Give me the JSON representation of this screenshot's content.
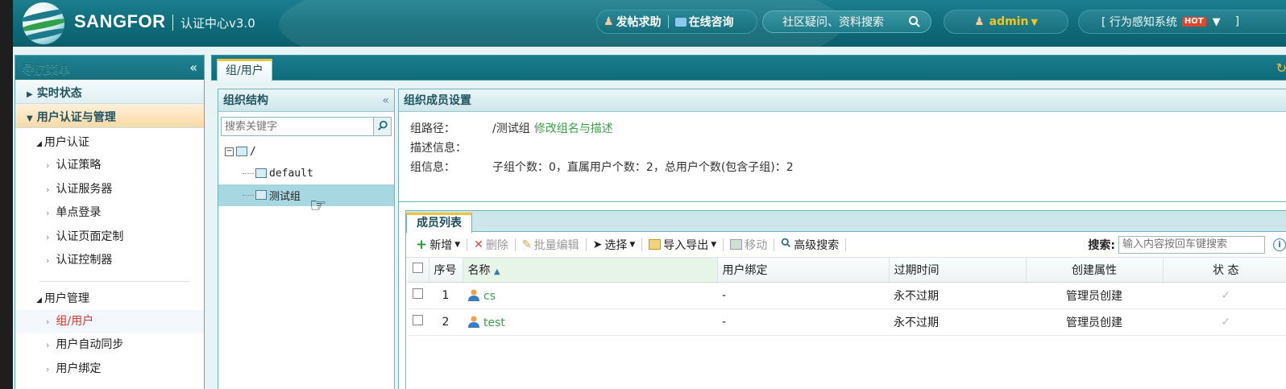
{
  "header": {
    "brand": "SANGFOR",
    "subtitle": "认证中心v3.0",
    "help_label": "发帖求助",
    "consult_label": "在线咨询",
    "search_placeholder": "社区疑问、资料搜索",
    "user": "admin",
    "behavior_label": "[ 行为感知系统",
    "hot_badge": "HOT",
    "close_bracket": "]"
  },
  "nav": {
    "title": "导航菜单",
    "sections": [
      {
        "label": "实时状态"
      },
      {
        "label": "用户认证与管理"
      }
    ],
    "groups": [
      {
        "label": "用户认证",
        "items": [
          "认证策略",
          "认证服务器",
          "单点登录",
          "认证页面定制",
          "认证控制器"
        ]
      },
      {
        "label": "用户管理",
        "items": [
          "组/用户",
          "用户自动同步",
          "用户绑定"
        ]
      }
    ]
  },
  "tabs": {
    "active": "组/用户"
  },
  "org": {
    "title": "组织结构",
    "search_placeholder": "搜索关键字",
    "tree": [
      {
        "label": "/"
      },
      {
        "label": "default"
      },
      {
        "label": "测试组"
      }
    ]
  },
  "member": {
    "title": "组织成员设置",
    "path_label": "组路径：",
    "path_value": "/测试组",
    "path_link": "修改组名与描述",
    "desc_label": "描述信息：",
    "desc_value": "",
    "group_label": "组信息：",
    "group_value": "子组个数：0，直属用户个数：2，总用户个数(包含子组)：2",
    "list_tab": "成员列表",
    "toolbar": {
      "add": "新增",
      "delete": "删除",
      "batch_edit": "批量编辑",
      "select": "选择",
      "import_export": "导入导出",
      "move": "移动",
      "advanced_search": "高级搜索",
      "search_label": "搜索:",
      "search_placeholder": "输入内容按回车键搜索"
    },
    "columns": [
      "序号",
      "名称",
      "用户绑定",
      "过期时间",
      "创建属性",
      "状 态"
    ],
    "rows": [
      {
        "no": "1",
        "name": "cs",
        "binding": "-",
        "expiry": "永不过期",
        "created": "管理员创建"
      },
      {
        "no": "2",
        "name": "test",
        "binding": "-",
        "expiry": "永不过期",
        "created": "管理员创建"
      }
    ]
  },
  "colors": {
    "accent": "#0f6a79",
    "link_green": "#3aa346",
    "active_red": "#d6342a",
    "tab_gold": "#f0c13c"
  }
}
